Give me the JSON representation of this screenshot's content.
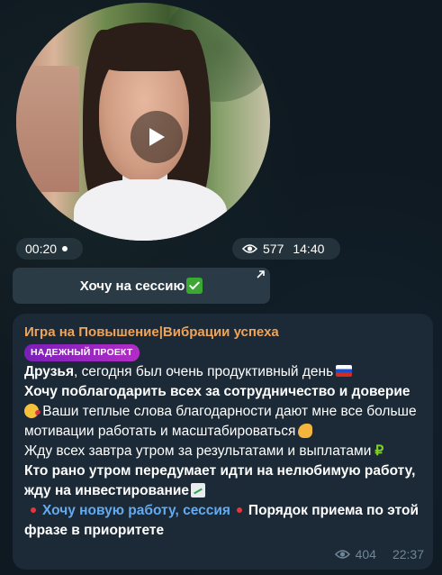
{
  "video": {
    "duration": "00:20",
    "views": "577",
    "time": "14:40"
  },
  "button": {
    "label": "Хочу на сессию"
  },
  "message": {
    "sender": "Игра на Повышение|Вибрации успеха",
    "badge": "НАДЕЖНЫЙ ПРОЕКТ",
    "line1_bold": "Друзья",
    "line1_rest": ", сегодня был очень продуктивный день",
    "line2_bold": "Хочу поблагодарить всех за сотрудничество и доверие",
    "line2_rest": " Ваши теплые слова благодарности дают мне все больше мотивации работать и масштабироваться",
    "line3": "Жду всех завтра утром за результатами и выплатами",
    "line3_symbol": "₽",
    "line4_bold": "Кто рано утром передумает идти на нелюбимую работу, жду на инвестирование",
    "link": "Хочу новую работу, сессия",
    "line5_bold": "Порядок приема по этой фразе в приоритете",
    "views": "404",
    "time": "22:37"
  }
}
